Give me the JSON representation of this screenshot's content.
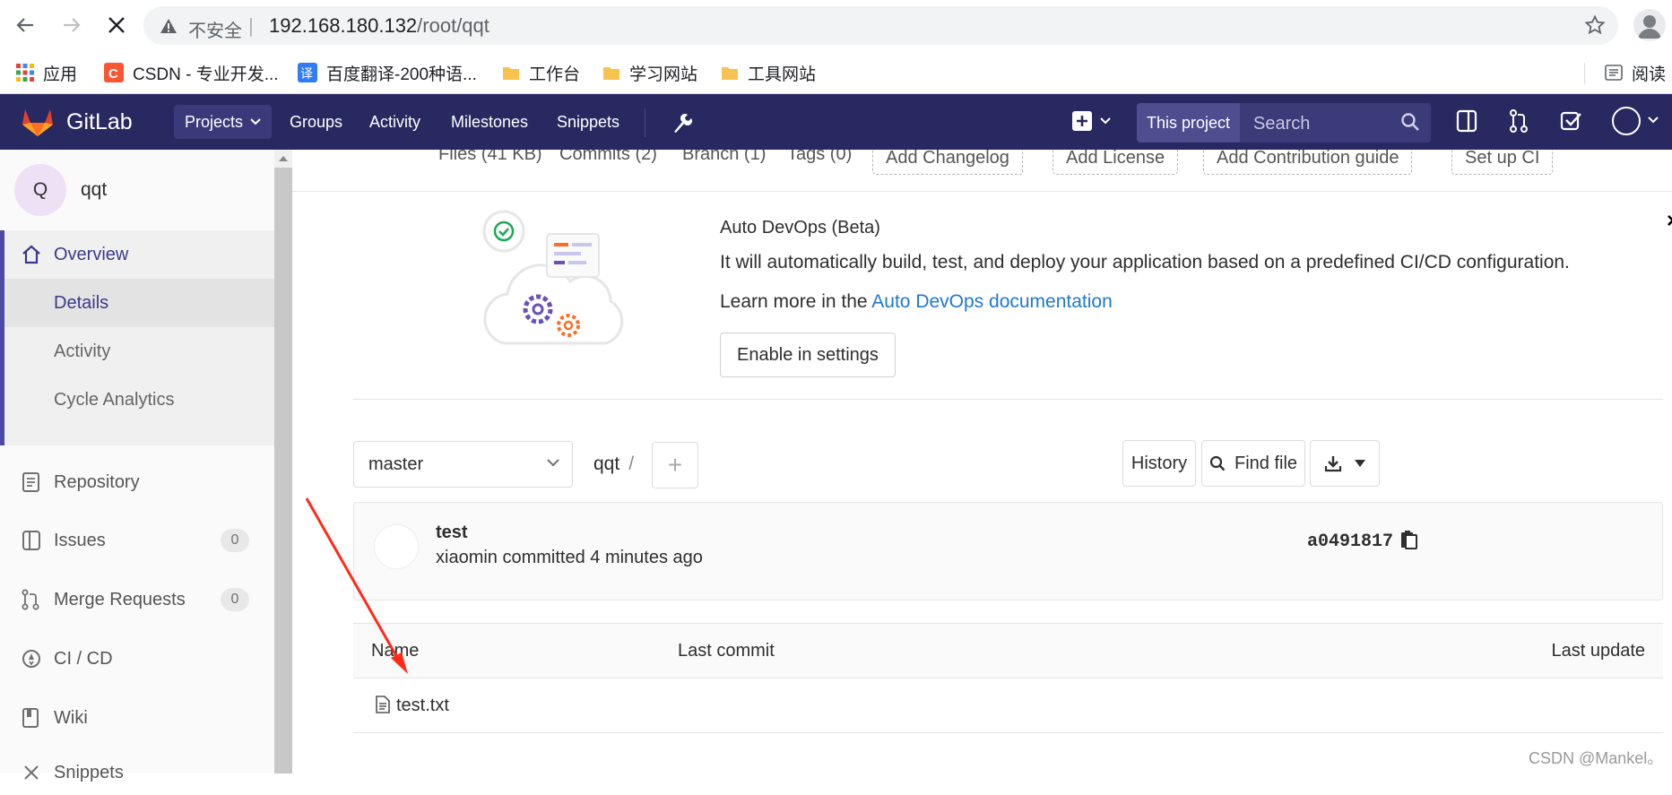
{
  "browser": {
    "address": {
      "insecure_label": "不安全",
      "separator": "|",
      "host": "192.168.180.132",
      "path": "/root/qqt"
    },
    "bookmarks": [
      {
        "label": "应用",
        "icon": "apps-grid-icon"
      },
      {
        "label": "CSDN - 专业开发...",
        "icon": "csdn-icon"
      },
      {
        "label": "百度翻译-200种语...",
        "icon": "translate-icon"
      },
      {
        "label": "工作台",
        "icon": "folder-icon"
      },
      {
        "label": "学习网站",
        "icon": "folder-icon"
      },
      {
        "label": "工具网站",
        "icon": "folder-icon"
      },
      {
        "label": "阅读",
        "icon": "reading-list-icon"
      }
    ]
  },
  "gitlab": {
    "brand": "GitLab",
    "nav": [
      "Projects",
      "Groups",
      "Activity",
      "Milestones",
      "Snippets"
    ],
    "search": {
      "scope": "This project",
      "placeholder": "Search"
    },
    "accent": "#292961"
  },
  "sidebar": {
    "project_initial": "Q",
    "project_name": "qqt",
    "overview": "Overview",
    "sub_items": [
      "Details",
      "Activity",
      "Cycle Analytics"
    ],
    "items": [
      {
        "label": "Repository",
        "icon": "book-icon"
      },
      {
        "label": "Issues",
        "icon": "issues-icon",
        "count": "0"
      },
      {
        "label": "Merge Requests",
        "icon": "merge-request-icon",
        "count": "0"
      },
      {
        "label": "CI / CD",
        "icon": "rocket-icon"
      },
      {
        "label": "Wiki",
        "icon": "wiki-icon"
      },
      {
        "label": "Snippets",
        "icon": "scissors-icon"
      }
    ]
  },
  "stats": {
    "files": "Files (41 KB)",
    "commits": "Commits (2)",
    "branch": "Branch (1)",
    "tags": "Tags (0)",
    "add_changelog": "Add Changelog",
    "add_license": "Add License",
    "add_contribution": "Add Contribution guide",
    "setup_ci": "Set up CI"
  },
  "devops": {
    "title": "Auto DevOps (Beta)",
    "description": "It will automatically build, test, and deploy your application based on a predefined CI/CD configuration.",
    "learn_prefix": "Learn more in the ",
    "learn_link": "Auto DevOps documentation",
    "enable_button": "Enable in settings",
    "close": "×"
  },
  "tree": {
    "branch": "master",
    "path_root": "qqt",
    "path_sep": "/",
    "add": "+",
    "history": "History",
    "find_file": "Find file"
  },
  "commit": {
    "title": "test",
    "author_line": "xiaomin committed 4 minutes ago",
    "sha": "a0491817"
  },
  "files": {
    "columns": [
      "Name",
      "Last commit",
      "Last update"
    ],
    "rows": [
      {
        "name": "test.txt"
      }
    ]
  },
  "watermark": "CSDN @Mankel。"
}
